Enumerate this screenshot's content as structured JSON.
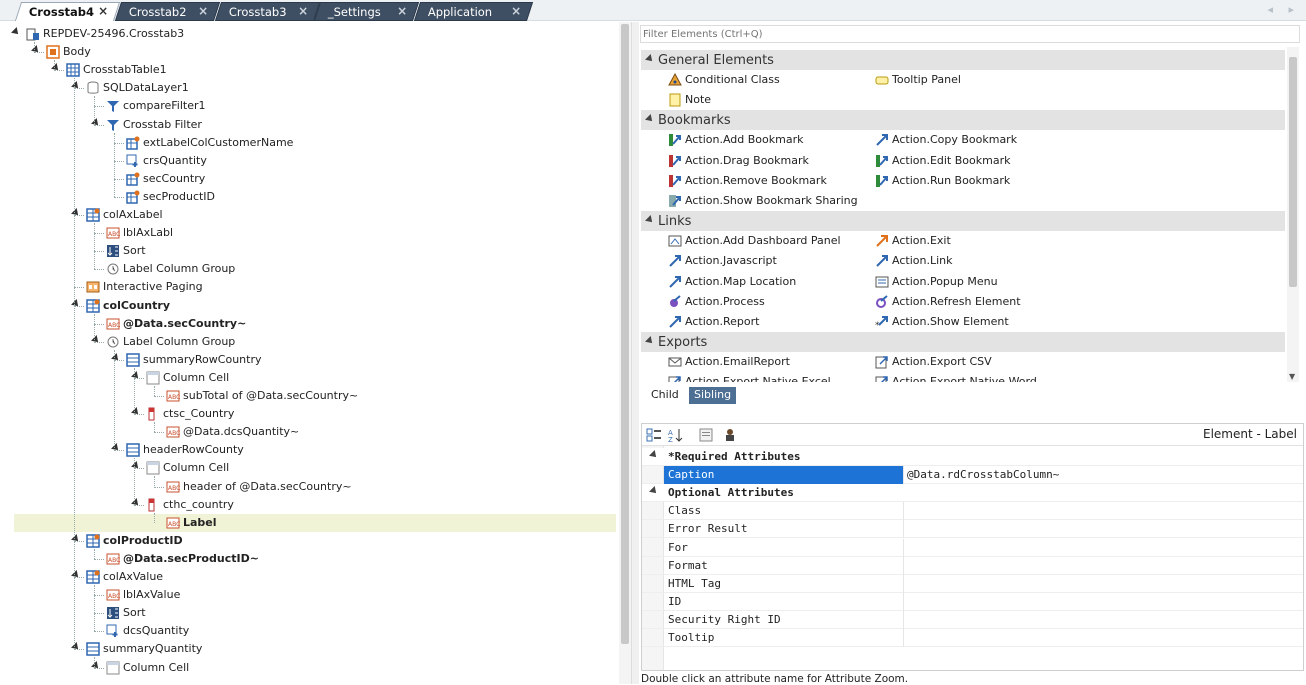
{
  "tabs": [
    {
      "label": "Crosstab4",
      "active": true
    },
    {
      "label": "Crosstab2",
      "active": false
    },
    {
      "label": "Crosstab3",
      "active": false
    },
    {
      "label": "_Settings",
      "active": false
    },
    {
      "label": "Application",
      "active": false
    }
  ],
  "tree": [
    {
      "label": "REPDEV-25496.Crosstab3",
      "level": 0,
      "expanded": true,
      "icon": "report-icon"
    },
    {
      "label": "Body",
      "level": 1,
      "expanded": true,
      "icon": "body-icon"
    },
    {
      "label": "CrosstabTable1",
      "level": 2,
      "expanded": true,
      "icon": "table-icon"
    },
    {
      "label": "SQLDataLayer1",
      "level": 3,
      "expanded": true,
      "icon": "datalayer-icon"
    },
    {
      "label": "compareFilter1",
      "level": 4,
      "expanded": null,
      "icon": "filter-icon"
    },
    {
      "label": "Crosstab Filter",
      "level": 4,
      "expanded": true,
      "icon": "filter-icon"
    },
    {
      "label": "extLabelColCustomerName",
      "level": 5,
      "expanded": null,
      "icon": "table-gear-icon"
    },
    {
      "label": "crsQuantity",
      "level": 5,
      "expanded": null,
      "icon": "calc-icon"
    },
    {
      "label": "secCountry",
      "level": 5,
      "expanded": null,
      "icon": "table-gear-icon"
    },
    {
      "label": "secProductID",
      "level": 5,
      "expanded": null,
      "icon": "table-gear-icon"
    },
    {
      "label": "colAxLabel",
      "level": 3,
      "expanded": true,
      "icon": "column-icon"
    },
    {
      "label": "lblAxLabl",
      "level": 4,
      "expanded": null,
      "icon": "label-icon"
    },
    {
      "label": "Sort",
      "level": 4,
      "expanded": null,
      "icon": "sort-icon"
    },
    {
      "label": "Label Column Group",
      "level": 4,
      "expanded": null,
      "icon": "group-icon"
    },
    {
      "label": "Interactive Paging",
      "level": 3,
      "expanded": null,
      "icon": "paging-icon"
    },
    {
      "label": "colCountry",
      "level": 3,
      "expanded": true,
      "icon": "column-icon",
      "bold": true
    },
    {
      "label": "@Data.secCountry~",
      "level": 4,
      "expanded": null,
      "icon": "label-icon",
      "bold": true
    },
    {
      "label": "Label Column Group",
      "level": 4,
      "expanded": true,
      "icon": "group-icon"
    },
    {
      "label": "summaryRowCountry",
      "level": 5,
      "expanded": true,
      "icon": "row-icon"
    },
    {
      "label": "Column Cell",
      "level": 6,
      "expanded": true,
      "icon": "cell-icon"
    },
    {
      "label": "subTotal of @Data.secCountry~",
      "level": 7,
      "expanded": null,
      "icon": "label-icon"
    },
    {
      "label": "ctsc_Country",
      "level": 6,
      "expanded": true,
      "icon": "summary-cell-icon"
    },
    {
      "label": "@Data.dcsQuantity~",
      "level": 7,
      "expanded": null,
      "icon": "label-icon"
    },
    {
      "label": "headerRowCounty",
      "level": 5,
      "expanded": true,
      "icon": "row-icon"
    },
    {
      "label": "Column Cell",
      "level": 6,
      "expanded": true,
      "icon": "cell-icon"
    },
    {
      "label": "header of @Data.secCountry~",
      "level": 7,
      "expanded": null,
      "icon": "label-icon"
    },
    {
      "label": "cthc_country",
      "level": 6,
      "expanded": true,
      "icon": "summary-cell-icon"
    },
    {
      "label": "Label",
      "level": 7,
      "expanded": null,
      "icon": "label-icon",
      "selected": true
    },
    {
      "label": "colProductID",
      "level": 3,
      "expanded": true,
      "icon": "column-icon",
      "bold": true
    },
    {
      "label": "@Data.secProductID~",
      "level": 4,
      "expanded": null,
      "icon": "label-icon",
      "bold": true
    },
    {
      "label": "colAxValue",
      "level": 3,
      "expanded": true,
      "icon": "column-icon"
    },
    {
      "label": "lblAxValue",
      "level": 4,
      "expanded": null,
      "icon": "label-icon"
    },
    {
      "label": "Sort",
      "level": 4,
      "expanded": null,
      "icon": "sort-icon"
    },
    {
      "label": "dcsQuantity",
      "level": 4,
      "expanded": null,
      "icon": "calc-icon"
    },
    {
      "label": "summaryQuantity",
      "level": 3,
      "expanded": true,
      "icon": "row-icon"
    },
    {
      "label": "Column Cell",
      "level": 4,
      "expanded": true,
      "icon": "cell-icon"
    }
  ],
  "filter": {
    "placeholder": "Filter Elements (Ctrl+Q)"
  },
  "toolbox": {
    "categories": [
      {
        "name": "General Elements",
        "items": [
          {
            "label": "Conditional Class",
            "icon": "conditional-class-icon"
          },
          {
            "label": "Tooltip Panel",
            "icon": "tooltip-panel-icon"
          },
          {
            "label": "Note",
            "icon": "note-icon"
          }
        ]
      },
      {
        "name": "Bookmarks",
        "items": [
          {
            "label": "Action.Add Bookmark",
            "icon": "bookmark-add-icon"
          },
          {
            "label": "Action.Copy Bookmark",
            "icon": "bookmark-copy-icon"
          },
          {
            "label": "Action.Drag Bookmark",
            "icon": "bookmark-drag-icon"
          },
          {
            "label": "Action.Edit Bookmark",
            "icon": "bookmark-edit-icon"
          },
          {
            "label": "Action.Remove Bookmark",
            "icon": "bookmark-remove-icon"
          },
          {
            "label": "Action.Run Bookmark",
            "icon": "bookmark-run-icon"
          },
          {
            "label": "Action.Show Bookmark Sharing",
            "icon": "bookmark-share-icon"
          }
        ]
      },
      {
        "name": "Links",
        "items": [
          {
            "label": "Action.Add Dashboard Panel",
            "icon": "dashboard-panel-icon"
          },
          {
            "label": "Action.Exit",
            "icon": "exit-icon"
          },
          {
            "label": "Action.Javascript",
            "icon": "javascript-icon"
          },
          {
            "label": "Action.Link",
            "icon": "link-icon"
          },
          {
            "label": "Action.Map Location",
            "icon": "map-location-icon"
          },
          {
            "label": "Action.Popup Menu",
            "icon": "popup-menu-icon"
          },
          {
            "label": "Action.Process",
            "icon": "process-icon"
          },
          {
            "label": "Action.Refresh Element",
            "icon": "refresh-element-icon"
          },
          {
            "label": "Action.Report",
            "icon": "report-action-icon"
          },
          {
            "label": "Action.Show Element",
            "icon": "show-element-icon"
          }
        ]
      },
      {
        "name": "Exports",
        "items": [
          {
            "label": "Action.EmailReport",
            "icon": "email-report-icon"
          },
          {
            "label": "Action.Export CSV",
            "icon": "export-csv-icon"
          },
          {
            "label": "Action.Export Native Excel",
            "icon": "export-excel-icon"
          },
          {
            "label": "Action.Export Native Word",
            "icon": "export-word-icon"
          }
        ]
      }
    ]
  },
  "child_tabs": [
    {
      "label": "Child",
      "active": false
    },
    {
      "label": "Sibling",
      "active": true
    }
  ],
  "attributes": {
    "element_label": "Element - Label",
    "required_header": "*Required Attributes",
    "required": [
      {
        "name": "Caption",
        "value": "@Data.rdCrosstabColumn~",
        "selected": true
      }
    ],
    "optional_header": "Optional Attributes",
    "optional": [
      {
        "name": "Class",
        "value": ""
      },
      {
        "name": "Error Result",
        "value": ""
      },
      {
        "name": "For",
        "value": ""
      },
      {
        "name": "Format",
        "value": ""
      },
      {
        "name": "HTML Tag",
        "value": ""
      },
      {
        "name": "ID",
        "value": ""
      },
      {
        "name": "Security Right ID",
        "value": ""
      },
      {
        "name": "Tooltip",
        "value": ""
      }
    ]
  },
  "hint": "Double click an attribute name for Attribute Zoom.",
  "colors": {
    "tab_dark": "#3f4f63",
    "selection_blue": "#1e74d6",
    "selected_row": "#f0f3d6",
    "sibling_tab": "#4e6f94"
  }
}
